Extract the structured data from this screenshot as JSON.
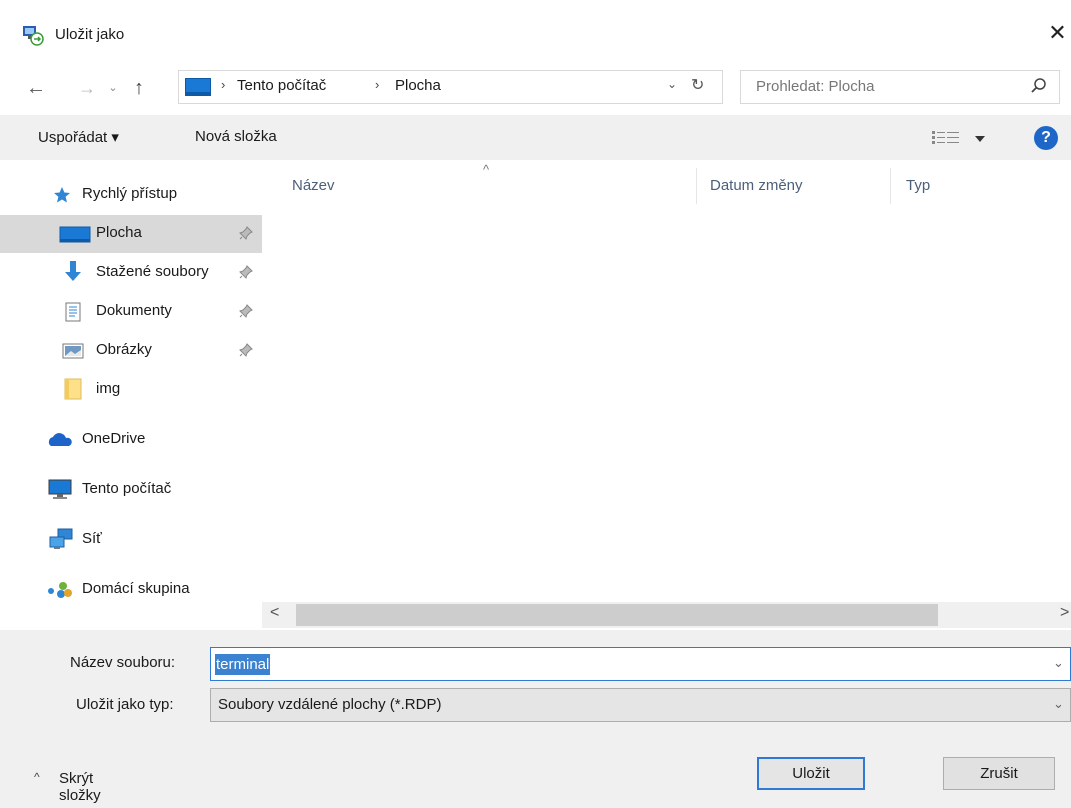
{
  "window": {
    "title": "Uložit jako",
    "close_glyph": "✕"
  },
  "nav": {
    "back_glyph": "←",
    "forward_glyph": "→",
    "recent_glyph": "⌄",
    "up_glyph": "↑",
    "breadcrumb": [
      "Tento počítač",
      "Plocha"
    ],
    "breadcrumb_separator": "›",
    "dropdown_glyph": "⌄",
    "refresh_glyph": "↻"
  },
  "search": {
    "placeholder": "Prohledat: Plocha"
  },
  "toolbar": {
    "organize_label": "Uspořádat ▾",
    "new_folder_label": "Nová složka",
    "help_glyph": "?"
  },
  "sidebar": {
    "items": [
      {
        "label": "Rychlý přístup",
        "icon": "star-pin-icon"
      },
      {
        "label": "Plocha",
        "icon": "desktop-icon",
        "pinned": true,
        "selected": true
      },
      {
        "label": "Stažené soubory",
        "icon": "download-icon",
        "pinned": true
      },
      {
        "label": "Dokumenty",
        "icon": "document-icon",
        "pinned": true
      },
      {
        "label": "Obrázky",
        "icon": "pictures-icon",
        "pinned": true
      },
      {
        "label": "img",
        "icon": "folder-icon"
      },
      {
        "label": "OneDrive",
        "icon": "onedrive-icon"
      },
      {
        "label": "Tento počítač",
        "icon": "computer-icon"
      },
      {
        "label": "Síť",
        "icon": "network-icon"
      },
      {
        "label": "Domácí skupina",
        "icon": "homegroup-icon"
      }
    ]
  },
  "list": {
    "sort_glyph": "^",
    "columns": [
      "Název",
      "Datum změny",
      "Typ"
    ],
    "scroll_left_glyph": "<",
    "scroll_right_glyph": ">"
  },
  "form": {
    "filename_label": "Název souboru:",
    "filename_value": "terminal",
    "filetype_label": "Uložit jako typ:",
    "filetype_value": "Soubory vzdálené plochy (*.RDP)",
    "dropdown_glyph": "⌄"
  },
  "footer": {
    "hide_glyph": "^",
    "hide_folders_label": "Skrýt složky",
    "save_label": "Uložit",
    "cancel_label": "Zrušit"
  },
  "colors": {
    "accent": "#2f7ad6",
    "selection": "#3b82d1",
    "help": "#1e67c9"
  }
}
